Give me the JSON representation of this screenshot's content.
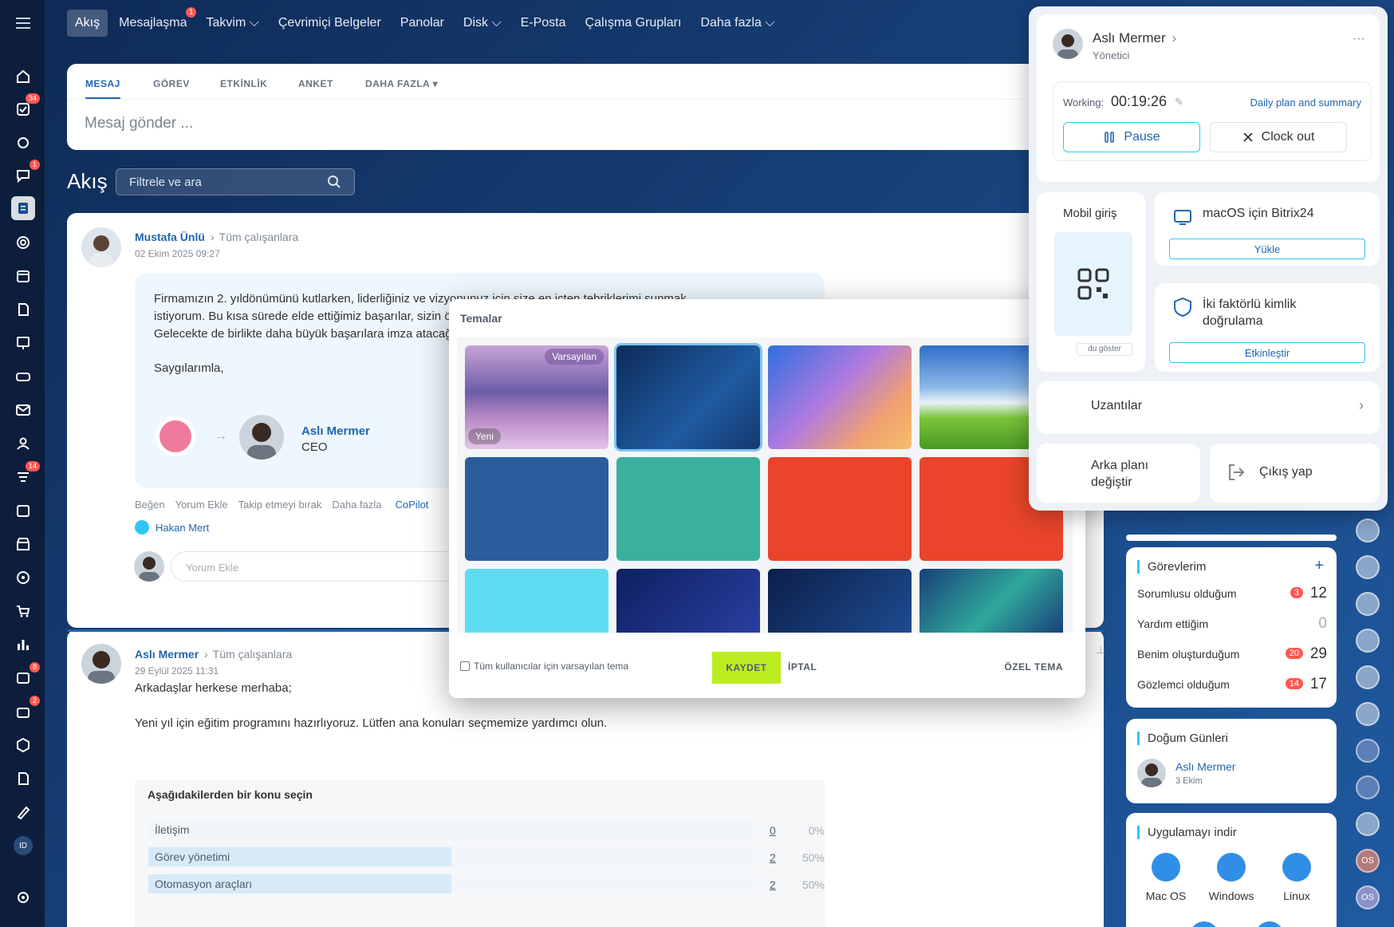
{
  "topnav": {
    "items": [
      {
        "label": "Akış",
        "active": true
      },
      {
        "label": "Mesajlaşma",
        "badge": "1"
      },
      {
        "label": "Takvim ⌵"
      },
      {
        "label": "Çevrimiçi Belgeler"
      },
      {
        "label": "Panolar"
      },
      {
        "label": "Disk ⌵"
      },
      {
        "label": "E-Posta"
      },
      {
        "label": "Çalışma Grupları"
      },
      {
        "label": "Daha fazla ⌵"
      }
    ]
  },
  "rail": {
    "badges": {
      "tasks": "34",
      "chat": "1",
      "feed2": "14",
      "news": "8",
      "crm": "2"
    },
    "id_label": "ID"
  },
  "composer": {
    "tabs": [
      "MESAJ",
      "GÖREV",
      "ETKİNLİK",
      "ANKET",
      "DAHA FAZLA ▾"
    ],
    "placeholder": "Mesaj gönder ..."
  },
  "feed": {
    "title": "Akış",
    "filter_placeholder": "Filtrele ve ara"
  },
  "post1": {
    "author": "Mustafa Ünlü",
    "audience": "Tüm çalışanlara",
    "date": "02 Ekim 2025 09:27",
    "lines": [
      "Firmamızın 2. yıldönümünü kutlarken, liderliğiniz ve vizyonunuz için size en içten tebriklerimi sunmak",
      "istiyorum. Bu kısa sürede elde ettiğimiz başarılar, sizin ö",
      "Gelecekte de birlikte daha büyük başarılara imza atacağ"
    ],
    "sign": "Saygılarımla,",
    "recipient_name": "Aslı Mermer",
    "recipient_role": "CEO",
    "actions": [
      "Beğen",
      "Yorum Ekle",
      "Takip etmeyi bırak",
      "Daha fazla",
      "CoPilot"
    ],
    "liker": "Hakan Mert",
    "comment_placeholder": "Yorum Ekle"
  },
  "post2": {
    "author": "Aslı Mermer",
    "audience": "Tüm çalışanlara",
    "date": "29 Eylül 2025 11:31",
    "line1": "Arkadaşlar herkese merhaba;",
    "line2": "Yeni yıl için eğitim programını hazırlıyoruz. Lütfen ana konuları seçmemize yardımcı olun.",
    "poll_title": "Aşağıdakilerden bir konu seçin",
    "poll": [
      {
        "label": "İletişim",
        "votes": "0",
        "pct": "0%",
        "fill": 0
      },
      {
        "label": "Görev yönetimi",
        "votes": "2",
        "pct": "50%",
        "fill": 0.5
      },
      {
        "label": "Otomasyon araçları",
        "votes": "2",
        "pct": "50%",
        "fill": 0.5
      }
    ]
  },
  "modal": {
    "title": "Temalar",
    "badge_default": "Varsayılan",
    "badge_new": "Yeni",
    "checkbox_label": "Tüm kullanıcılar için varsayılan tema",
    "save": "KAYDET",
    "cancel": "İPTAL",
    "custom": "ÖZEL TEMA",
    "close": "×"
  },
  "popup": {
    "name": "Aslı Mermer",
    "role": "Yönetici",
    "working_label": "Working:",
    "timer": "00:19:26",
    "daily_link": "Daily plan and summary",
    "pause": "Pause",
    "clockout": "Clock out",
    "mobile_title": "Mobil giriş",
    "mobile_show": "du göster",
    "macos_title": "macOS için Bitrix24",
    "macos_btn": "Yükle",
    "twofa_title_1": "İki faktörlü kimlik",
    "twofa_title_2": "doğrulama",
    "twofa_btn": "Etkinleştir",
    "extensions": "Uzantılar",
    "bg_change_1": "Arka planı",
    "bg_change_2": "değiştir",
    "logout": "Çıkış yap",
    "more": "···"
  },
  "tasks": {
    "title": "Görevlerim",
    "rows": [
      {
        "label": "Sorumlusu olduğum",
        "badge": "3",
        "count": "12"
      },
      {
        "label": "Yardım ettiğim",
        "badge": "",
        "count": "0"
      },
      {
        "label": "Benim oluşturduğum",
        "badge": "20",
        "count": "29"
      },
      {
        "label": "Gözlemci olduğum",
        "badge": "14",
        "count": "17"
      }
    ]
  },
  "birthdays": {
    "title": "Doğum Günleri",
    "name": "Aslı Mermer",
    "date": "3 Ekim"
  },
  "apps": {
    "title": "Uygulamayı indir",
    "items": [
      "Mac OS",
      "Windows",
      "Linux"
    ]
  },
  "far_right": {
    "os1": "OS",
    "os2": "OS"
  },
  "colors": {
    "accent": "#2066b0",
    "save": "#bbed21",
    "badge": "#ff5752"
  }
}
